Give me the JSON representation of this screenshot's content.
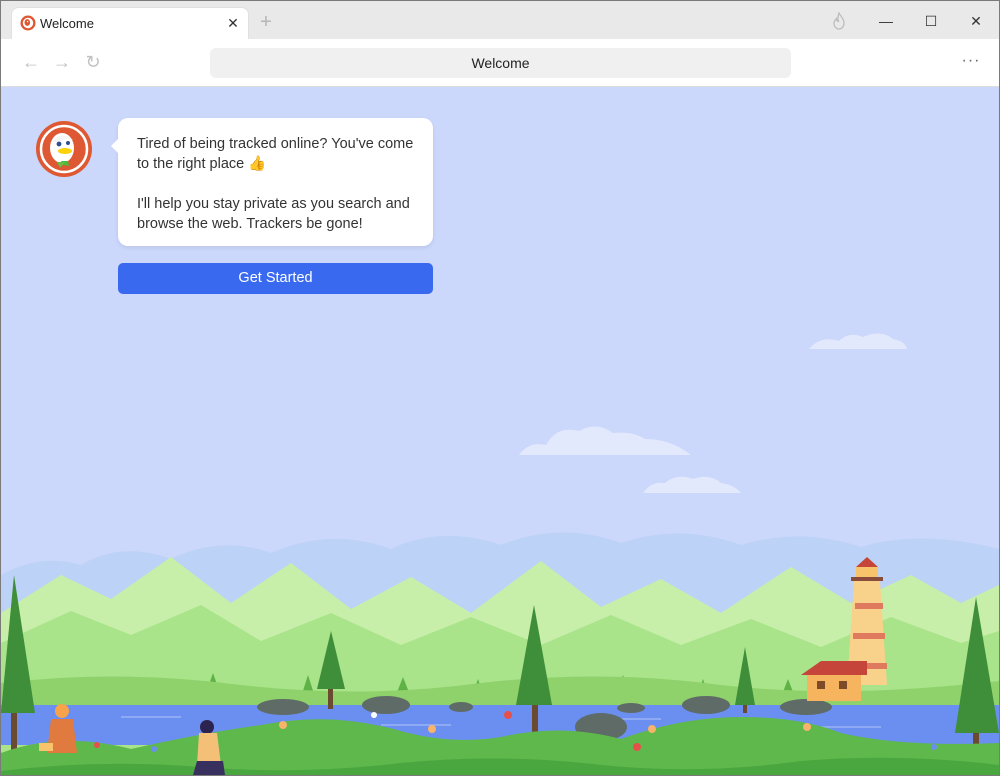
{
  "browser": {
    "tab": {
      "title": "Welcome",
      "close_glyph": "✕",
      "favicon": "duckduckgo-logo"
    },
    "new_tab_glyph": "+",
    "window_controls": {
      "minimize": "—",
      "maximize": "☐",
      "close": "✕"
    },
    "toolbar": {
      "back_glyph": "←",
      "forward_glyph": "→",
      "reload_glyph": "↻",
      "address": "Welcome",
      "menu_glyph": "···"
    }
  },
  "page": {
    "message_line1": "Tired of being tracked online?  You've come to the right place 👍",
    "message_line2": "I'll help you stay private as you search and browse the web. Trackers be gone!",
    "cta_label": "Get Started"
  },
  "colors": {
    "accent": "#3969ef",
    "page_background": "#cbd7fb",
    "brand_orange": "#de5833"
  }
}
